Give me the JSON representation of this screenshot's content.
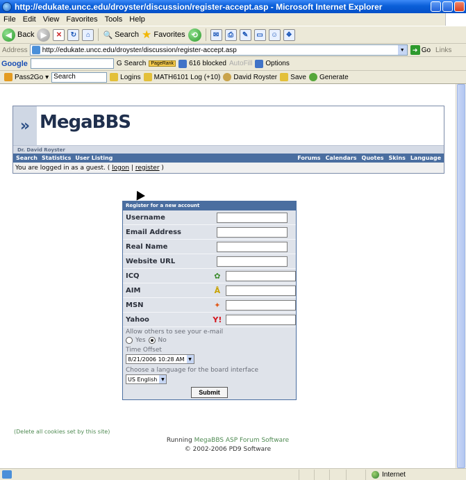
{
  "window": {
    "title": "http://edukate.uncc.edu/droyster/discussion/register-accept.asp - Microsoft Internet Explorer"
  },
  "menubar": {
    "items": [
      "File",
      "Edit",
      "View",
      "Favorites",
      "Tools",
      "Help"
    ]
  },
  "toolbar": {
    "back_label": "Back",
    "search_label": "Search",
    "favorites_label": "Favorites"
  },
  "address": {
    "label": "Address",
    "url": "http://edukate.uncc.edu/droyster/discussion/register-accept.asp",
    "go_label": "Go",
    "links_label": "Links"
  },
  "googlebar": {
    "logo": "Google",
    "search_label": "Search",
    "pagerank_label": "PageRank",
    "blocked_label": "616 blocked",
    "autofill_label": "AutoFill",
    "options_label": "Options"
  },
  "linksbar": {
    "pass2go_label": "Pass2Go",
    "search_placeholder": "Search",
    "logins_label": "Logins",
    "math_label": "MATH6101 Log (+10)",
    "user_label": "David Royster",
    "save_label": "Save",
    "generate_label": "Generate"
  },
  "bbs": {
    "logo_text": "MegaBBS",
    "owner": "Dr. David Royster",
    "nav_left": [
      "Search",
      "Statistics",
      "User Listing"
    ],
    "nav_right": [
      "Forums",
      "Calendars",
      "Quotes",
      "Skins",
      "Language"
    ],
    "status_prefix": "You are logged in as a guest. (",
    "logon_label": "logon",
    "register_label": "register",
    "status_suffix": ")"
  },
  "register_form": {
    "heading": "Register for a new account",
    "fields": [
      {
        "label": "Username"
      },
      {
        "label": "Email Address"
      },
      {
        "label": "Real Name"
      },
      {
        "label": "Website URL"
      }
    ],
    "im_fields": [
      {
        "label": "ICQ",
        "icon": "icq-flower-icon",
        "color": "#3a8a2a"
      },
      {
        "label": "AIM",
        "icon": "aim-runner-icon",
        "color": "#c8a200"
      },
      {
        "label": "MSN",
        "icon": "msn-butterfly-icon",
        "color": "#e05a1a"
      },
      {
        "label": "Yahoo",
        "icon": "yahoo-icon",
        "color": "#d4141c"
      }
    ],
    "email_visibility_label": "Allow others to see your e-mail",
    "yes_label": "Yes",
    "no_label": "No",
    "email_visibility_value": "No",
    "time_offset_label": "Time Offset",
    "time_offset_value": "8/21/2006 10:28 AM",
    "language_label": "Choose a language for the board interface",
    "language_value": "US English",
    "submit_label": "Submit"
  },
  "footer": {
    "cookies_link": "(Delete all cookies set by this site)",
    "running_prefix": "Running",
    "running_link": "MegaBBS ASP Forum Software",
    "copyright": "© 2002-2006 PD9 Software"
  },
  "statusbar": {
    "zone": "Internet"
  }
}
